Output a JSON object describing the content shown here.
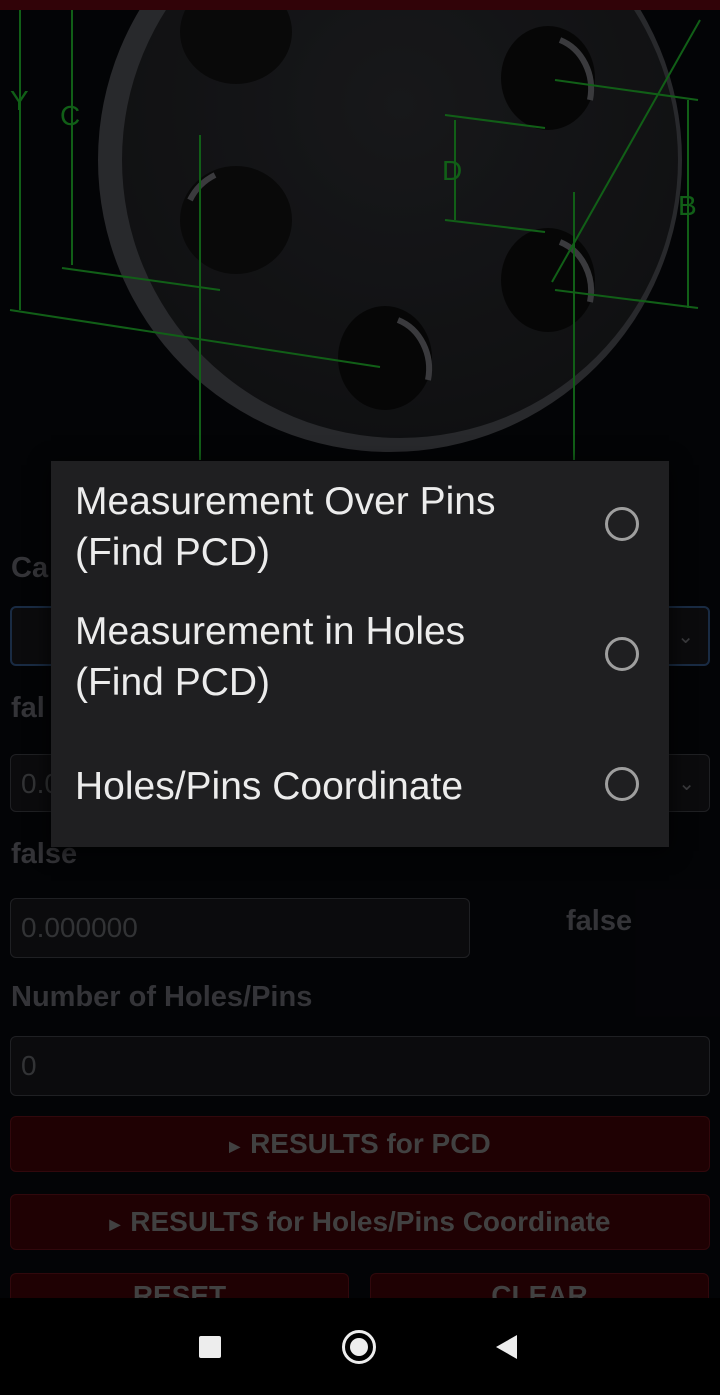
{
  "diagram": {
    "dimension_labels": [
      "Y",
      "C",
      "D",
      "B"
    ]
  },
  "form": {
    "select_label_partial": "Ca",
    "label_false_1": "fal",
    "value_field_partial": "0.0",
    "label_false_2": "false",
    "value_field_2": "0.000000",
    "label_false_3": "false",
    "holes_label": "Number of Holes/Pins",
    "holes_value": "0",
    "chevron": "⌄"
  },
  "buttons": {
    "results_pcd": "RESULTS for PCD",
    "results_coord": "RESULTS for Holes/Pins Coordinate",
    "reset": "RESET",
    "clear": "CLEAR",
    "arrow": "▶"
  },
  "dialog": {
    "options": [
      {
        "label_line1": "Measurement Over Pins",
        "label_line2": "(Find PCD)",
        "selected": false
      },
      {
        "label_line1": "Measurement in Holes",
        "label_line2": "(Find PCD)",
        "selected": false
      },
      {
        "label_line1": "Holes/Pins Coordinate",
        "label_line2": "",
        "selected": false
      }
    ]
  },
  "colors": {
    "dimension_line": "#1fae2a",
    "accent_red": "#3a0306"
  }
}
